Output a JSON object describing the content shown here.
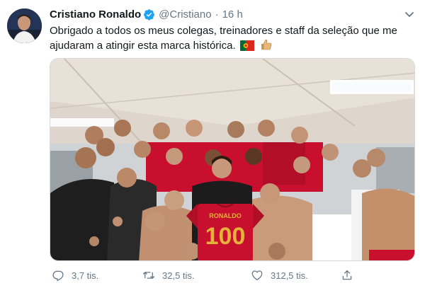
{
  "tweet": {
    "name": "Cristiano Ronaldo",
    "handle": "@Cristiano",
    "separator": "·",
    "time": "16 h",
    "text": "Obrigado a todos os meus colegas, treinadores e staff da seleção que me ajudaram a atingir esta marca histórica.",
    "jersey_text": "RONALDO",
    "jersey_number": "100"
  },
  "actions": {
    "replies": "3,7 tis.",
    "retweets": "32,5 tis.",
    "likes": "312,5 tis."
  },
  "icons": {
    "verified": "verified-badge-icon",
    "chevron": "chevron-down-icon",
    "reply": "reply-icon",
    "retweet": "retweet-icon",
    "like": "heart-icon",
    "share": "share-icon",
    "flag": "portugal-flag-icon",
    "emoji": "thumbs-up-icon"
  },
  "colors": {
    "brand_blue": "#1da1f2",
    "muted_text": "#657786",
    "jersey_red": "#c8102e",
    "jersey_gold": "#e4b23c"
  }
}
